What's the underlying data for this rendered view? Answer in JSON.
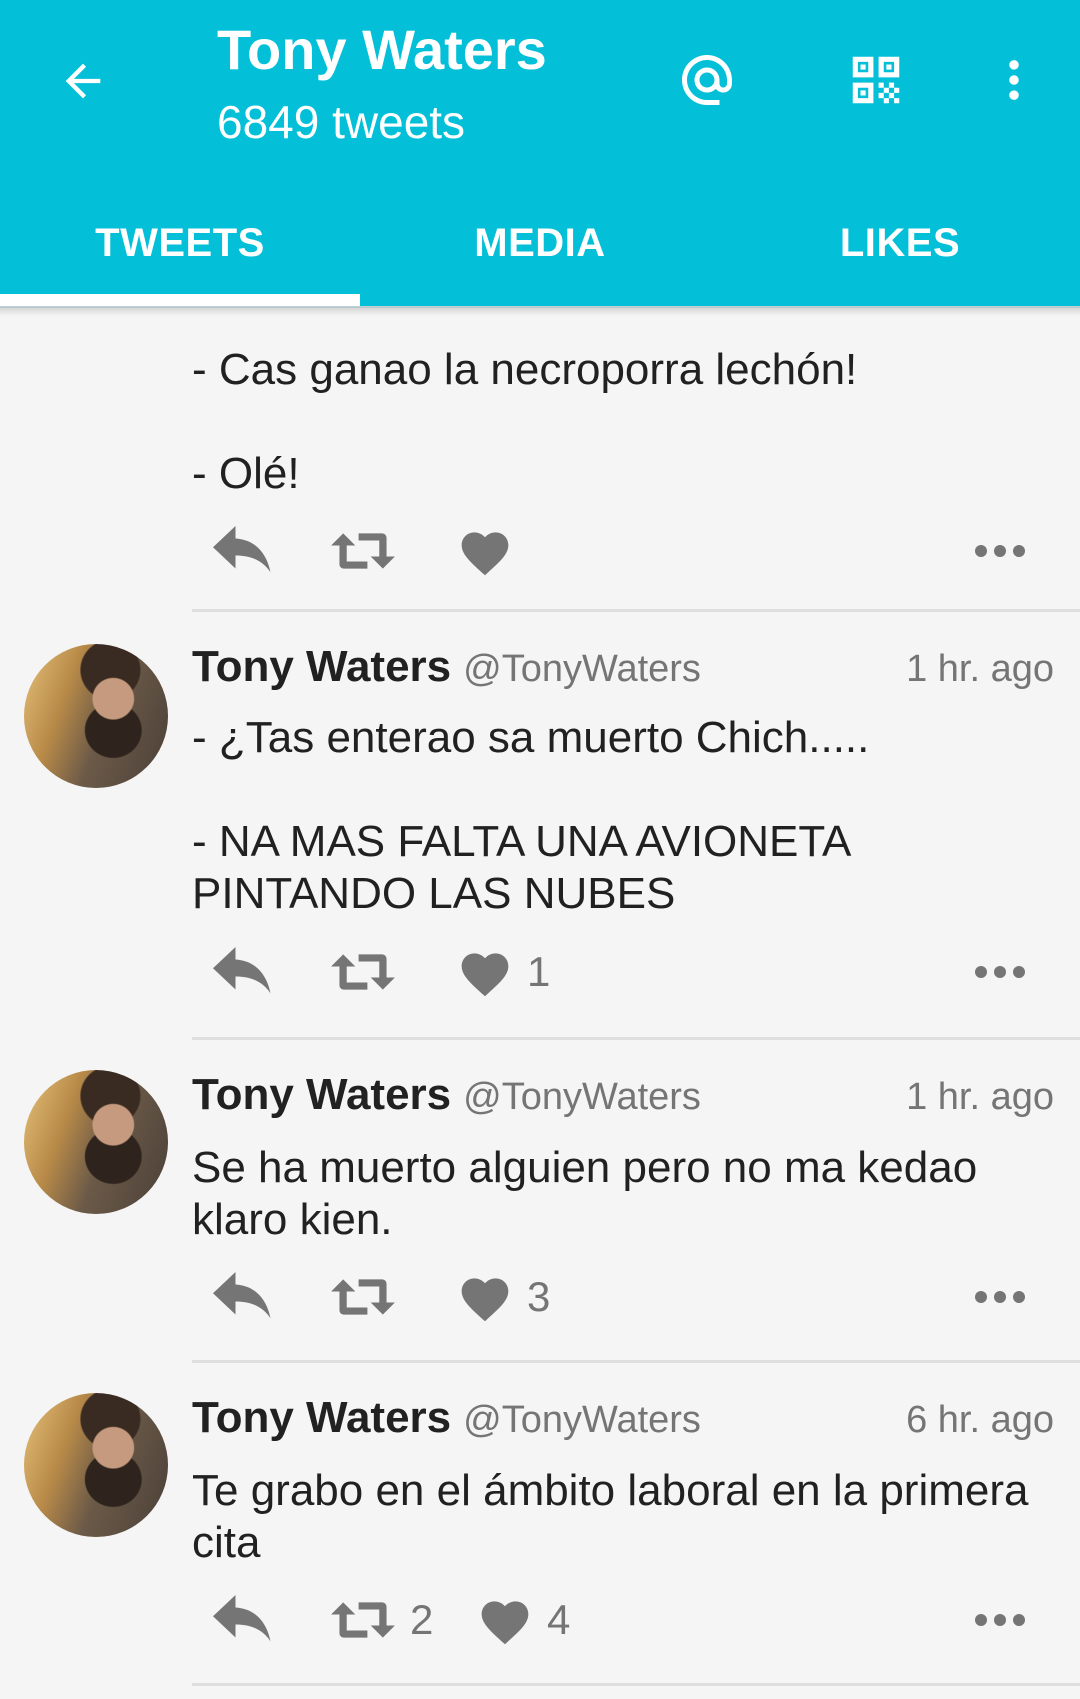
{
  "header": {
    "title": "Tony Waters",
    "subtitle": "6849 tweets",
    "icons": [
      "back-arrow-icon",
      "mention-icon",
      "qr-code-icon",
      "overflow-menu-icon"
    ],
    "accent_color": "#03bfd8"
  },
  "tabs": [
    {
      "label": "TWEETS",
      "selected": true
    },
    {
      "label": "MEDIA",
      "selected": false
    },
    {
      "label": "LIKES",
      "selected": false
    }
  ],
  "tweets": [
    {
      "name": "",
      "handle": "",
      "time": "",
      "text": "- Cas ganao la necroporra lechón!\n\n- Olé!",
      "retweets": "",
      "likes": ""
    },
    {
      "name": "Tony Waters",
      "handle": "@TonyWaters",
      "time": "1 hr. ago",
      "text": "- ¿Tas enterao sa muerto Chich.....\n\n- NA MAS FALTA UNA AVIONETA PINTANDO LAS NUBES",
      "retweets": "",
      "likes": "1"
    },
    {
      "name": "Tony Waters",
      "handle": "@TonyWaters",
      "time": "1 hr. ago",
      "text": "Se ha muerto alguien pero no ma kedao klaro kien.",
      "retweets": "",
      "likes": "3"
    },
    {
      "name": "Tony Waters",
      "handle": "@TonyWaters",
      "time": "6 hr. ago",
      "text": "Te grabo en el ámbito laboral en la primera cita",
      "retweets": "2",
      "likes": "4"
    }
  ]
}
